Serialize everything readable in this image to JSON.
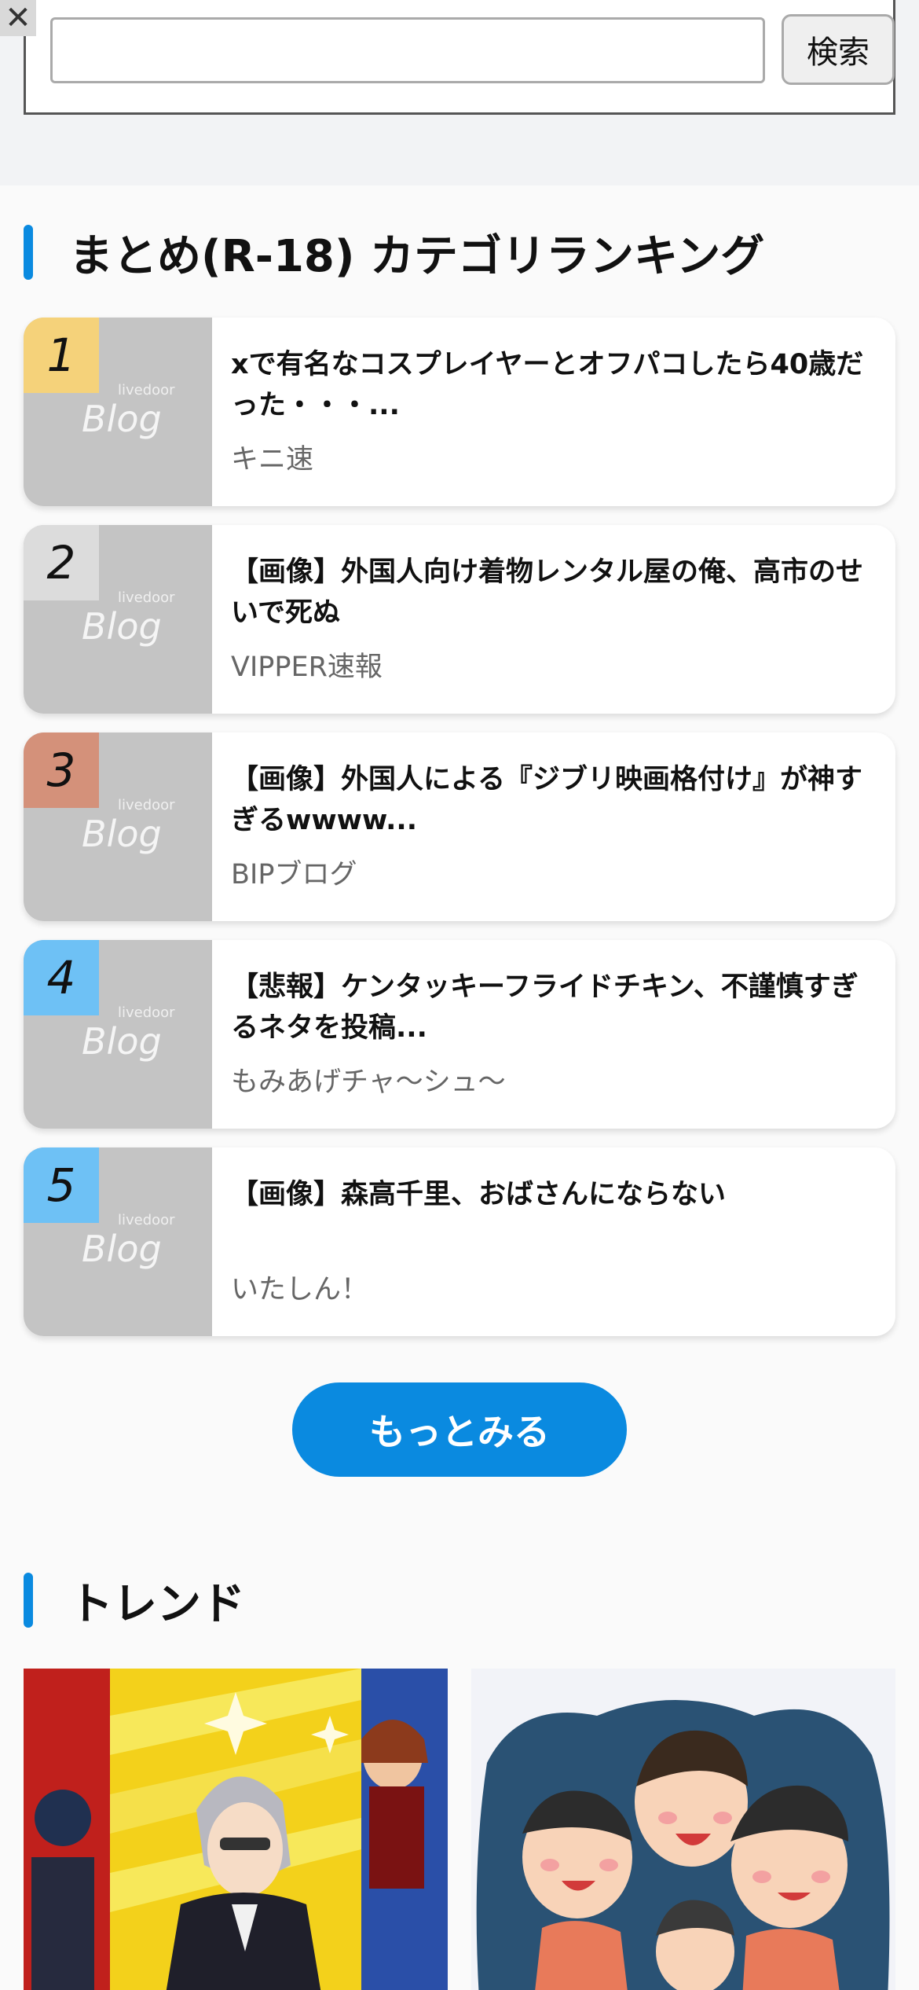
{
  "search": {
    "placeholder": "",
    "button_label": "検索"
  },
  "close_label": "✕",
  "ranking": {
    "title": "まとめ(R-18) カテゴリランキング",
    "items": [
      {
        "rank": "1",
        "title": "xで有名なコスプレイヤーとオフパコしたら40歳だった・・・...",
        "source": "キニ速",
        "badge_color": "#f5d27a"
      },
      {
        "rank": "2",
        "title": "【画像】外国人向け着物レンタル屋の俺、高市のせいで死ぬ",
        "source": "VIPPER速報",
        "badge_color": "#dcdcdc"
      },
      {
        "rank": "3",
        "title": "【画像】外国人による『ジブリ映画格付け』が神すぎるwwww...",
        "source": "BIPブログ",
        "badge_color": "#d4917a"
      },
      {
        "rank": "4",
        "title": "【悲報】ケンタッキーフライドチキン、不謹慎すぎるネタを投稿...",
        "source": "もみあげチャ～シュ～",
        "badge_color": "#6ec1f5"
      },
      {
        "rank": "5",
        "title": "【画像】森高千里、おばさんにならない",
        "source": "いたしん！",
        "badge_color": "#6ec1f5"
      }
    ],
    "thumb_brand": "livedoor",
    "thumb_logo": "Blog",
    "more_label": "もっとみる"
  },
  "trend": {
    "title": "トレンド"
  },
  "colors": {
    "accent": "#0a8ae0"
  }
}
